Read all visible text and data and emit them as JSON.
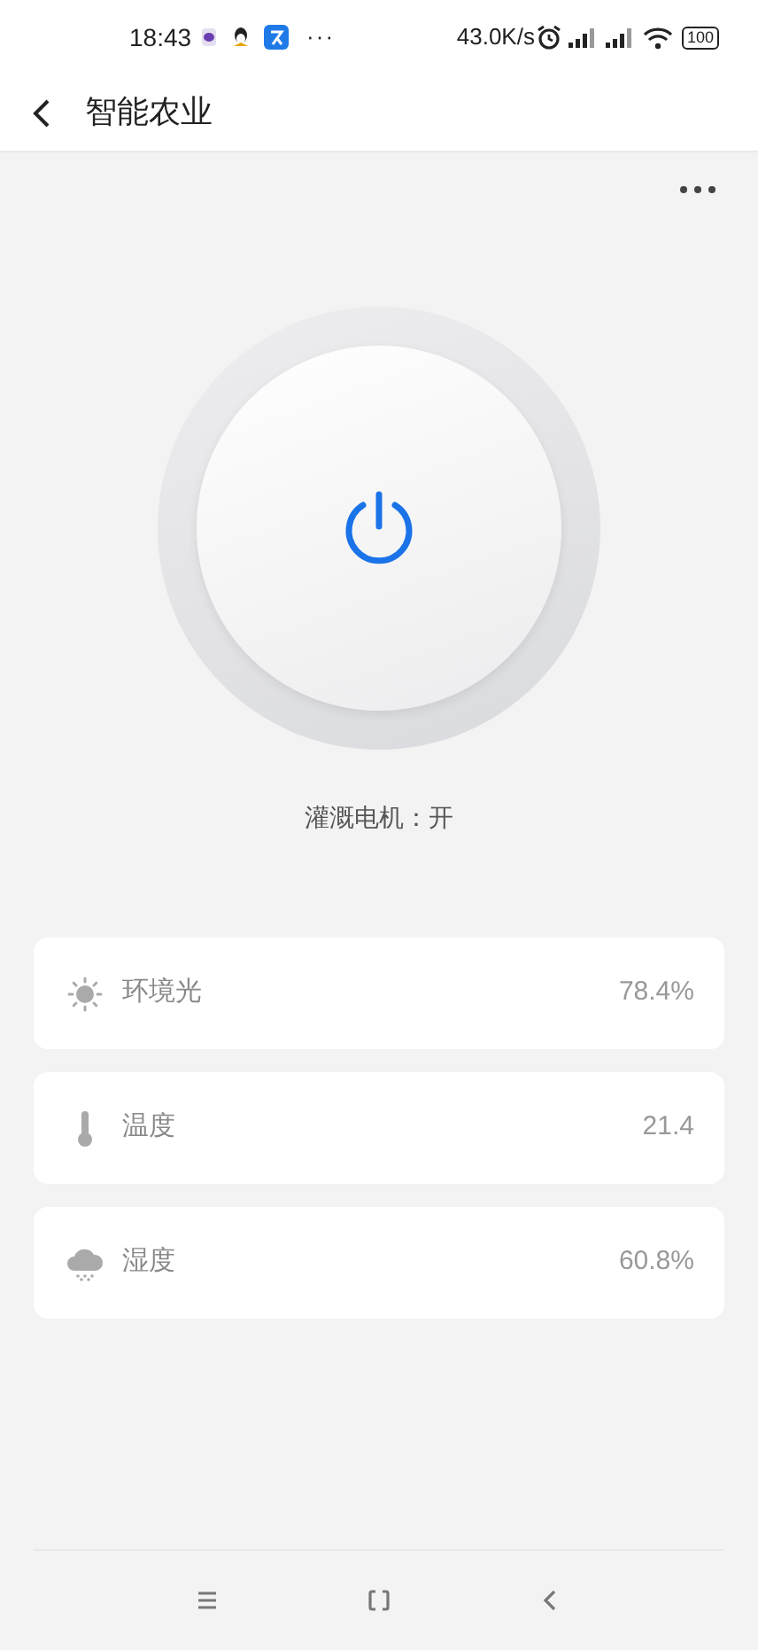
{
  "status_bar": {
    "time": "18:43",
    "more": "···",
    "speed": "43.0K/s",
    "battery": "100"
  },
  "nav_bar": {
    "title": "智能农业"
  },
  "motor": {
    "on": true,
    "label": "灌溉电机：开"
  },
  "sensors": [
    {
      "kind": "light",
      "label": "环境光",
      "value": "78.4%"
    },
    {
      "kind": "thermometer",
      "label": "温度",
      "value": "21.4"
    },
    {
      "kind": "cloud",
      "label": "湿度",
      "value": "60.8%"
    }
  ]
}
